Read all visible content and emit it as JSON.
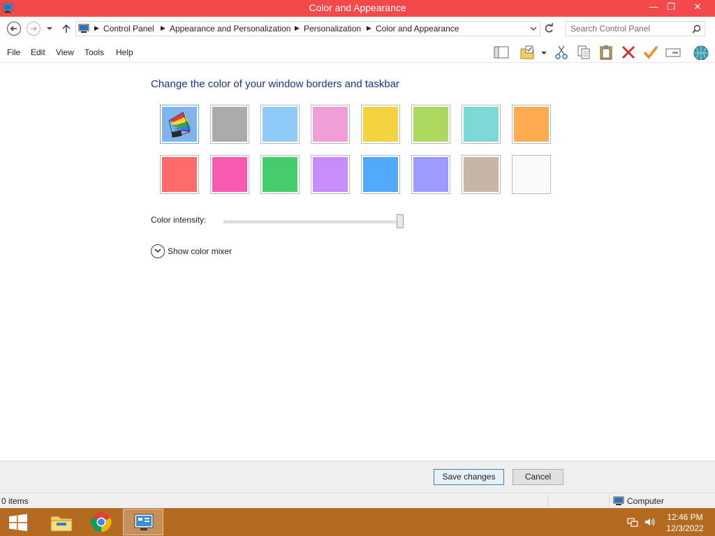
{
  "window": {
    "title": "Color and Appearance",
    "controls": {
      "minimize": "—",
      "maximize": "❐",
      "close": "✕"
    }
  },
  "address": {
    "crumbs": [
      "Control Panel",
      "Appearance and Personalization",
      "Personalization",
      "Color and Appearance"
    ],
    "search_placeholder": "Search Control Panel"
  },
  "menu": [
    "File",
    "Edit",
    "View",
    "Tools",
    "Help"
  ],
  "toolbar_icons": [
    "layout-pane-icon",
    "folder-checklist-icon",
    "cut-icon",
    "copy-icon",
    "paste-icon",
    "delete-icon",
    "check-icon",
    "rename-icon",
    "shell-icon"
  ],
  "main": {
    "title": "Change the color of your window borders and taskbar",
    "swatches": [
      {
        "name": "automatic",
        "color": "#7fb5ec",
        "selected": true
      },
      {
        "name": "gray",
        "color": "#ababab"
      },
      {
        "name": "light-blue",
        "color": "#8fcbf9"
      },
      {
        "name": "pink",
        "color": "#f19ed6"
      },
      {
        "name": "yellow",
        "color": "#f2d33f"
      },
      {
        "name": "lime",
        "color": "#acd85e"
      },
      {
        "name": "teal",
        "color": "#7cd9d6"
      },
      {
        "name": "orange",
        "color": "#ffab4f"
      },
      {
        "name": "red",
        "color": "#ff6b6b"
      },
      {
        "name": "magenta",
        "color": "#f65baf"
      },
      {
        "name": "green",
        "color": "#43cd6d"
      },
      {
        "name": "purple",
        "color": "#c88bfb"
      },
      {
        "name": "blue",
        "color": "#52aaff"
      },
      {
        "name": "periwinkle",
        "color": "#9b9bfd"
      },
      {
        "name": "taupe",
        "color": "#c6b6a8"
      },
      {
        "name": "white",
        "color": "#fafafa"
      }
    ],
    "intensity_label": "Color intensity:",
    "intensity_value": 1.0,
    "mixer_label": "Show color mixer"
  },
  "buttons": {
    "save": "Save changes",
    "cancel": "Cancel"
  },
  "status": {
    "items": "0 items",
    "location": "Computer"
  },
  "taskbar": {
    "apps": [
      "start-icon",
      "file-explorer-icon",
      "chrome-icon",
      "control-panel-icon"
    ],
    "time": "12:46 PM",
    "date": "12/3/2022"
  },
  "colors": {
    "titlebar": "#f4484a",
    "taskbar": "#b56a22",
    "title_text": "#1e3287"
  }
}
